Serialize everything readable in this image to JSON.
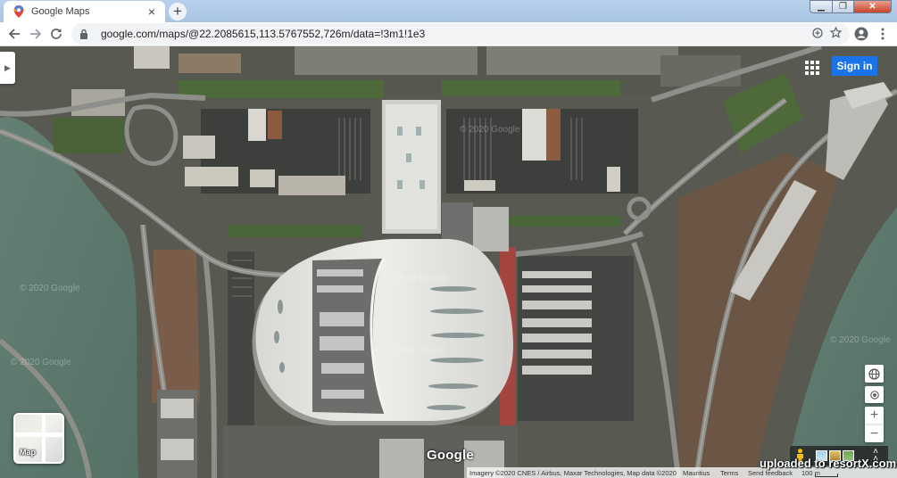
{
  "browser": {
    "tab_title": "Google Maps",
    "new_tab_label": "+",
    "tab_close_label": "×",
    "url": "google.com/maps/@22.2085615,113.5767552,726m/data=!3m1!1e3",
    "window_controls": {
      "minimize": "▁",
      "maximize": "❐",
      "close": "✕"
    }
  },
  "map": {
    "sign_in_label": "Sign in",
    "layer_toggle_label": "Map",
    "google_logo": "Google",
    "zoom_in_label": "+",
    "zoom_out_label": "−",
    "attribution": {
      "imagery": "Imagery ©2020 CNES / Airbus, Maxar Technologies, Map data ©2020",
      "region": "Mauritius",
      "terms": "Terms",
      "feedback": "Send feedback",
      "scale": "100 m"
    },
    "imagery_watermarks": [
      "© 2020 Google",
      "© 2020 Google",
      "© 2020 Google",
      "© 2020 Google",
      "© 2020 Google",
      "© 2020 Google"
    ],
    "upload_watermark": "uploaded to resortX.com"
  },
  "icons": {
    "favicon": "google-maps-pin-icon",
    "back": "back-arrow-icon",
    "forward": "forward-arrow-icon",
    "reload": "reload-icon",
    "lock": "lock-icon",
    "install": "add-circle-icon",
    "bookmark": "star-icon",
    "profile": "account-circle-icon",
    "menu": "more-vert-icon",
    "apps": "apps-grid-icon",
    "globe": "globe-icon",
    "location": "my-location-icon",
    "pegman": "pegman-icon",
    "expand": "expand-up-icon",
    "side_panel": "chevron-right-icon"
  },
  "colors": {
    "accent": "#1a73e8",
    "water": "#5e7d71",
    "roof": "#e6e6e2",
    "asphalt": "#3d3f3d",
    "vegetation": "#4e6a3a"
  }
}
